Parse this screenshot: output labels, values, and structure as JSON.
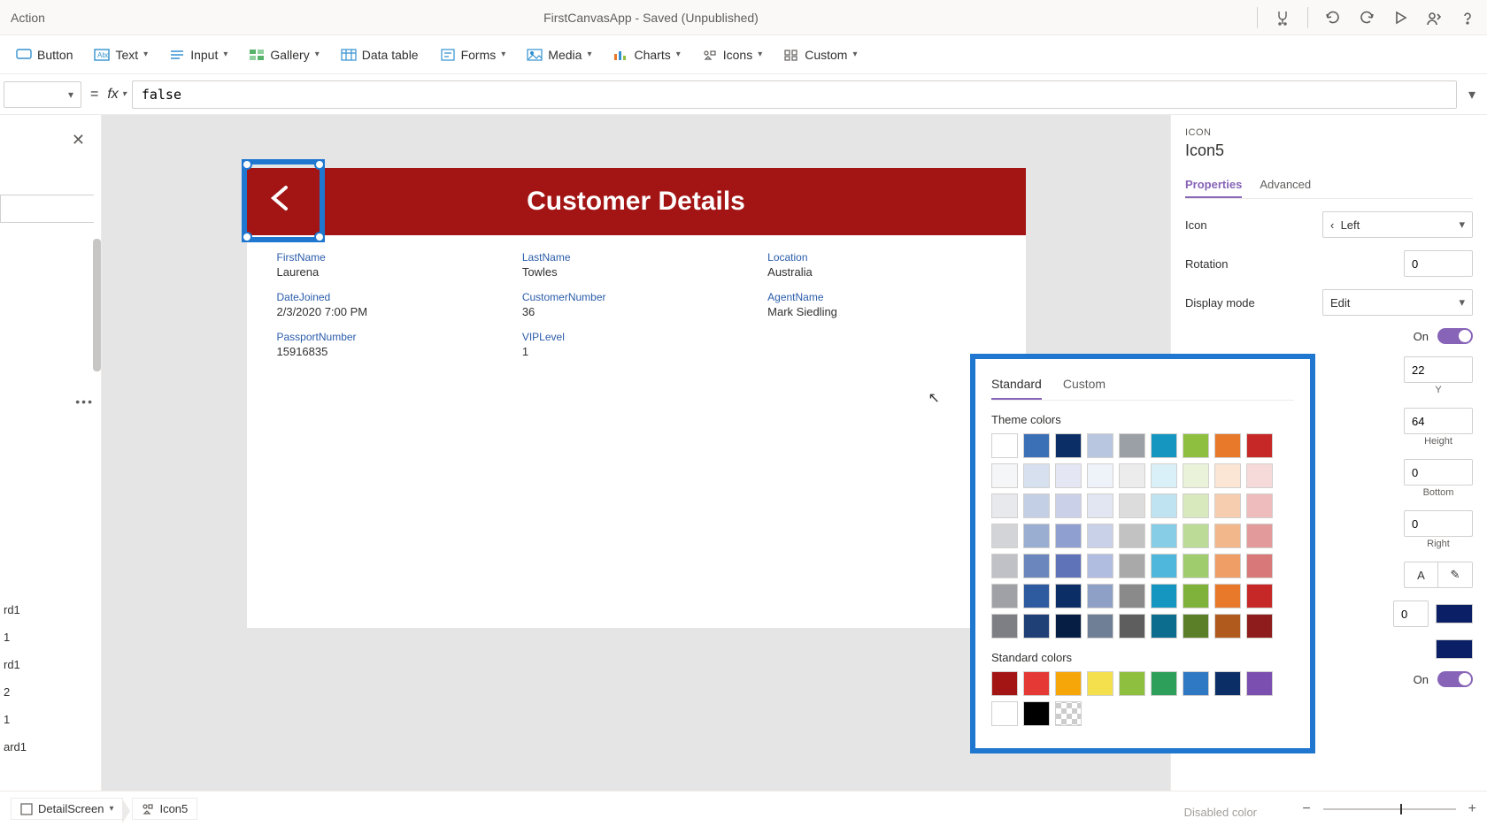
{
  "titlebar": {
    "menu": "Action",
    "appstate": "FirstCanvasApp - Saved (Unpublished)"
  },
  "ribbon": {
    "button": "Button",
    "text": "Text",
    "input": "Input",
    "gallery": "Gallery",
    "datatable": "Data table",
    "forms": "Forms",
    "media": "Media",
    "charts": "Charts",
    "icons": "Icons",
    "custom": "Custom"
  },
  "formula": {
    "value": "false"
  },
  "canvas": {
    "title": "Customer Details",
    "fields": {
      "firstname": {
        "label": "FirstName",
        "value": "Laurena"
      },
      "lastname": {
        "label": "LastName",
        "value": "Towles"
      },
      "location": {
        "label": "Location",
        "value": "Australia"
      },
      "datejoined": {
        "label": "DateJoined",
        "value": "2/3/2020 7:00 PM"
      },
      "custnum": {
        "label": "CustomerNumber",
        "value": "36"
      },
      "agent": {
        "label": "AgentName",
        "value": "Mark Siedling"
      },
      "passport": {
        "label": "PassportNumber",
        "value": "15916835"
      },
      "vip": {
        "label": "VIPLevel",
        "value": "1"
      }
    }
  },
  "tree": {
    "items": [
      "rd1",
      "1",
      "rd1",
      "2",
      "1",
      "ard1"
    ]
  },
  "props": {
    "kind": "ICON",
    "name": "Icon5",
    "tab_properties": "Properties",
    "tab_advanced": "Advanced",
    "icon_label": "Icon",
    "icon_value": "Left",
    "rotation_label": "Rotation",
    "rotation_value": "0",
    "display_label": "Display mode",
    "display_value": "Edit",
    "on": "On",
    "x_value": "22",
    "y_label": "Y",
    "w_value": "64",
    "h_label": "Height",
    "pt_value": "0",
    "pb_label": "Bottom",
    "pr_value": "0",
    "pr_label": "Right",
    "colorA": "#0a1f66",
    "colorB": "#0a1f66",
    "disabled_color": "Disabled color"
  },
  "picker": {
    "tab_standard": "Standard",
    "tab_custom": "Custom",
    "theme_label": "Theme colors",
    "standard_label": "Standard colors",
    "theme_rows": [
      [
        "#ffffff",
        "#3b6fb6",
        "#0b2e66",
        "#b9c6df",
        "#9aa0a6",
        "#1596c0",
        "#8fbf3f",
        "#e8792a",
        "#c62828"
      ],
      [
        "#f5f6f7",
        "#d7e0ef",
        "#e4e7f3",
        "#eef2f9",
        "#ececec",
        "#d9f0f8",
        "#eaf3da",
        "#fbe6d6",
        "#f6dada"
      ],
      [
        "#e7e9ec",
        "#c3cfe4",
        "#cad0e8",
        "#e1e6f2",
        "#dcdcdc",
        "#bfe3f1",
        "#d7e9bd",
        "#f7cdb0",
        "#eebcbc"
      ],
      [
        "#d2d4d8",
        "#9aaed2",
        "#8f9fcf",
        "#c9d1e8",
        "#c2c2c2",
        "#87cde6",
        "#bcdb96",
        "#f3b78c",
        "#e29a9a"
      ],
      [
        "#bfc1c6",
        "#6a86bd",
        "#5f73b8",
        "#b1bde0",
        "#a9a9a9",
        "#4fb7dc",
        "#9fcc6d",
        "#ef9e65",
        "#d87878"
      ],
      [
        "#9fa1a6",
        "#2e5aa0",
        "#0b2e66",
        "#8fa0c6",
        "#8a8a8a",
        "#1596c0",
        "#7fb23a",
        "#e8792a",
        "#c62828"
      ],
      [
        "#7d7f84",
        "#1f3f77",
        "#061d44",
        "#6f7f96",
        "#5e5e5e",
        "#0d6d8f",
        "#5a7f28",
        "#b15a1e",
        "#8e1c1c"
      ]
    ],
    "standard_rows": [
      [
        "#a31515",
        "#e53935",
        "#f6a609",
        "#f4e04d",
        "#8fbf3f",
        "#2e9e5b",
        "#2f78c4",
        "#0b2e66",
        "#7a4fb0"
      ],
      [
        "#ffffff",
        "#000000",
        "transparent"
      ]
    ]
  },
  "status": {
    "screen": "DetailScreen",
    "element": "Icon5"
  }
}
